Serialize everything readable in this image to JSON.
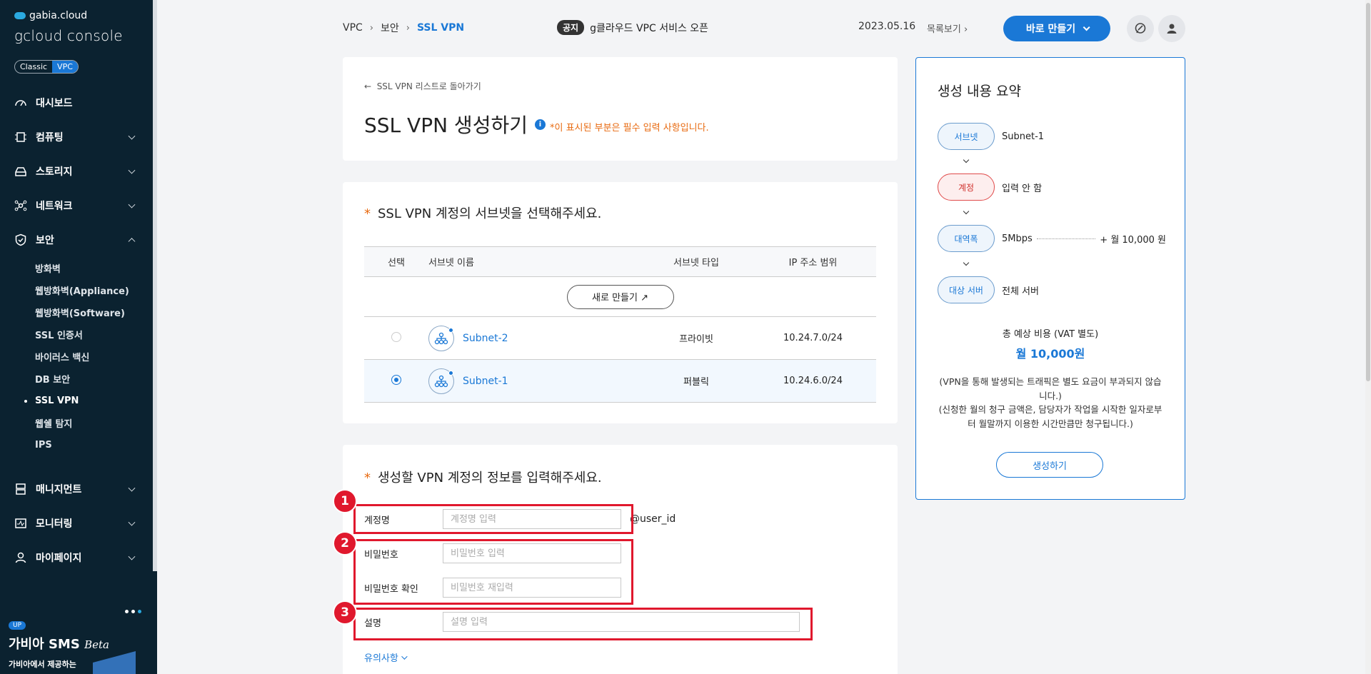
{
  "sidebar": {
    "brand_top": "gabia.cloud",
    "brand_main": "gcloud console",
    "mode_classic": "Classic",
    "mode_vpc": "VPC",
    "menu": [
      {
        "label": "대시보드",
        "icon": "dashboard-icon"
      },
      {
        "label": "컴퓨팅",
        "icon": "cpu-icon"
      },
      {
        "label": "스토리지",
        "icon": "storage-icon"
      },
      {
        "label": "네트워크",
        "icon": "network-icon"
      },
      {
        "label": "보안",
        "icon": "shield-icon"
      }
    ],
    "security_sub": [
      "방화벽",
      "웹방화벽(Appliance)",
      "웹방화벽(Software)",
      "SSL 인증서",
      "바이러스 백신",
      "DB 보안",
      "SSL VPN",
      "웹쉘 탐지",
      "IPS"
    ],
    "menu_bottom": [
      {
        "label": "매니지먼트",
        "icon": "management-icon"
      },
      {
        "label": "모니터링",
        "icon": "monitoring-icon"
      },
      {
        "label": "마이페이지",
        "icon": "user-icon"
      }
    ],
    "promo": {
      "badge": "UP",
      "title": "가비아 SMS",
      "title_em": "Beta",
      "sub": "가비아에서 제공하는"
    }
  },
  "topbar": {
    "breadcrumb": [
      "VPC",
      "보안",
      "SSL VPN"
    ],
    "notice_tag": "공지",
    "notice_text": "g클라우드 VPC 서비스 오픈",
    "date": "2023.05.16",
    "list_link": "목록보기",
    "make_button": "바로 만들기"
  },
  "header_card": {
    "back_link": "SSL VPN 리스트로 돌아가기",
    "title": "SSL VPN 생성하기",
    "required_note": "*이 표시된 부분은 필수 입력 사항입니다."
  },
  "subnet_section": {
    "title": "SSL VPN 계정의 서브넷을 선택해주세요.",
    "columns": [
      "선택",
      "서브넷 이름",
      "서브넷 타입",
      "IP 주소 범위"
    ],
    "new_button": "새로 만들기 ↗",
    "rows": [
      {
        "name": "Subnet-2",
        "type": "프라이빗",
        "range": "10.24.7.0/24",
        "selected": false
      },
      {
        "name": "Subnet-1",
        "type": "퍼블릭",
        "range": "10.24.6.0/24",
        "selected": true
      }
    ]
  },
  "account_section": {
    "title": "생성할 VPN 계정의 정보를 입력해주세요.",
    "account_label": "계정명",
    "account_placeholder": "계정명 입력",
    "account_suffix": "@user_id",
    "password_label": "비밀번호",
    "password_placeholder": "비밀번호 입력",
    "password_confirm_label": "비밀번호 확인",
    "password_confirm_placeholder": "비밀번호 재입력",
    "desc_label": "설명",
    "desc_placeholder": "설명 입력",
    "caution": "유의사항",
    "badges": [
      "1",
      "2",
      "3"
    ]
  },
  "summary": {
    "title": "생성 내용 요약",
    "steps": [
      {
        "pill": "서브넷",
        "value": "Subnet-1"
      },
      {
        "pill": "계정",
        "value": "입력 안 함"
      },
      {
        "pill": "대역폭",
        "value": "5Mbps",
        "price": "+ 월 10,000 원"
      },
      {
        "pill": "대상 서버",
        "value": "전체 서버"
      }
    ],
    "total_label": "총 예상 비용 (VAT 별도)",
    "total_amount": "월 10,000원",
    "fine_print_1": "(VPN을 통해 발생되는 트래픽은 별도 요금이 부과되지 않습니다.)",
    "fine_print_2": "(신청한 월의 청구 금액은, 담당자가 작업을 시작한 일자로부터 월말까지 이용한 시간만큼만 청구됩니다.)",
    "create_button": "생성하기"
  },
  "colors": {
    "accent": "#1a78d6",
    "sidebar_bg": "#0b2230",
    "required": "#e86a10",
    "highlight": "#e0182d"
  }
}
